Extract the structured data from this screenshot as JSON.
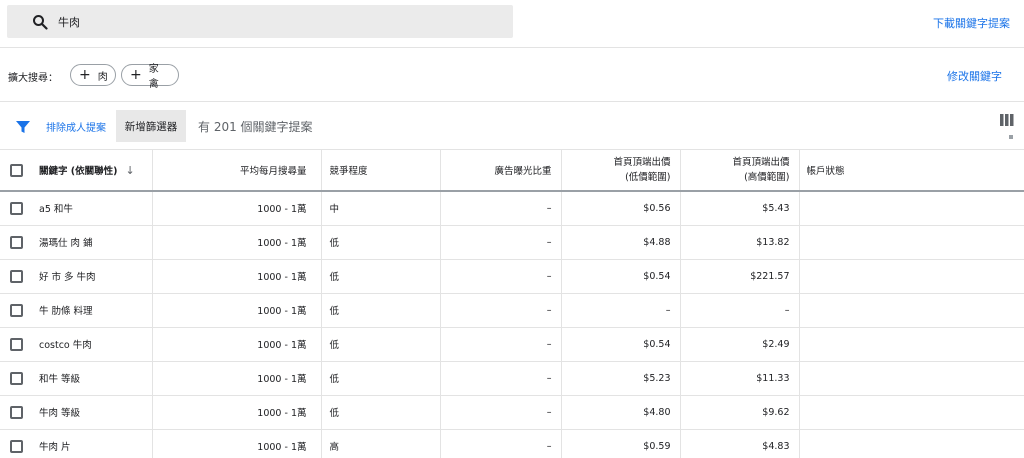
{
  "search": {
    "value": "牛肉"
  },
  "header": {
    "download_label": "下載關鍵字提案"
  },
  "broaden": {
    "label": "擴大搜尋：",
    "chips": [
      {
        "label": "肉"
      },
      {
        "label": "家禽"
      }
    ],
    "edit_label": "修改關鍵字"
  },
  "filters": {
    "exclude_label": "排除成人提案",
    "add_filter_label": "新增篩選器",
    "count_text": "有 201 個關鍵字提案"
  },
  "table": {
    "headers": {
      "keyword": "關鍵字 (依關聯性)",
      "volume": "平均每月搜尋量",
      "competition": "競爭程度",
      "impression_share": "廣告曝光比重",
      "bid_low_line1": "首頁頂端出價",
      "bid_low_line2": "(低價範圍)",
      "bid_high_line1": "首頁頂端出價",
      "bid_high_line2": "(高價範圍)",
      "status": "帳戶狀態"
    },
    "rows": [
      {
        "keyword": "a5 和牛",
        "volume": "1000 - 1萬",
        "competition": "中",
        "impression_share": "–",
        "bid_low": "$0.56",
        "bid_high": "$5.43"
      },
      {
        "keyword": "湯瑪仕 肉 鋪",
        "volume": "1000 - 1萬",
        "competition": "低",
        "impression_share": "–",
        "bid_low": "$4.88",
        "bid_high": "$13.82"
      },
      {
        "keyword": "好 市 多 牛肉",
        "volume": "1000 - 1萬",
        "competition": "低",
        "impression_share": "–",
        "bid_low": "$0.54",
        "bid_high": "$221.57"
      },
      {
        "keyword": "牛 肋條 料理",
        "volume": "1000 - 1萬",
        "competition": "低",
        "impression_share": "–",
        "bid_low": "–",
        "bid_high": "–"
      },
      {
        "keyword": "costco 牛肉",
        "volume": "1000 - 1萬",
        "competition": "低",
        "impression_share": "–",
        "bid_low": "$0.54",
        "bid_high": "$2.49"
      },
      {
        "keyword": "和牛 等級",
        "volume": "1000 - 1萬",
        "competition": "低",
        "impression_share": "–",
        "bid_low": "$5.23",
        "bid_high": "$11.33"
      },
      {
        "keyword": "牛肉 等級",
        "volume": "1000 - 1萬",
        "competition": "低",
        "impression_share": "–",
        "bid_low": "$4.80",
        "bid_high": "$9.62"
      },
      {
        "keyword": "牛肉 片",
        "volume": "1000 - 1萬",
        "competition": "高",
        "impression_share": "–",
        "bid_low": "$0.59",
        "bid_high": "$4.83"
      }
    ]
  },
  "icons": {
    "search": "search-icon",
    "filter": "filter-icon",
    "columns": "columns-icon",
    "sort": "arrow-down-icon",
    "plus": "plus-icon"
  },
  "colors": {
    "accent": "#1a73e8",
    "searchbar": "#ebebeb"
  }
}
